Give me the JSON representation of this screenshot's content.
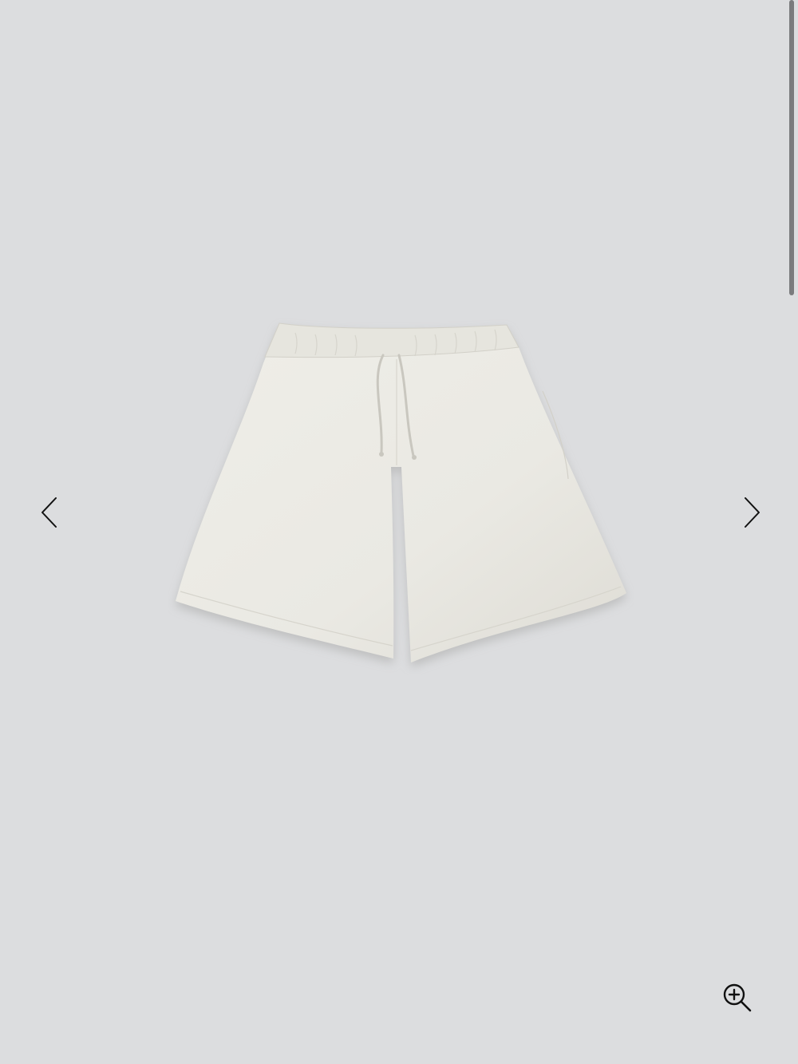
{
  "viewer": {
    "background": "#dcdddf",
    "image": {
      "subject": "sweat-shorts",
      "garment_color": "#ecebe5"
    },
    "controls": {
      "prev_icon": "chevron-left-icon",
      "next_icon": "chevron-right-icon",
      "zoom_icon": "zoom-in-icon"
    }
  },
  "scrollbar": {
    "thumb_color": "#7a7b7d"
  }
}
